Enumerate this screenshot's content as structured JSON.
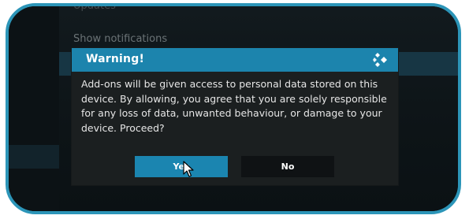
{
  "background": {
    "items": [
      "Updates",
      "Show notifications"
    ],
    "right_text": "..."
  },
  "dialog": {
    "title": "Warning!",
    "message": "Add-ons will be given access to personal data stored on this device. By allowing, you agree that you are solely responsible for any loss of data, unwanted behaviour, or damage to your device. Proceed?",
    "yes_label": "Yes",
    "no_label": "No",
    "logo_icon": "kodi-logo-icon"
  },
  "colors": {
    "accent": "#1c84ad",
    "frame": "#2c95b8",
    "dialog_bg": "#1b1f20"
  }
}
